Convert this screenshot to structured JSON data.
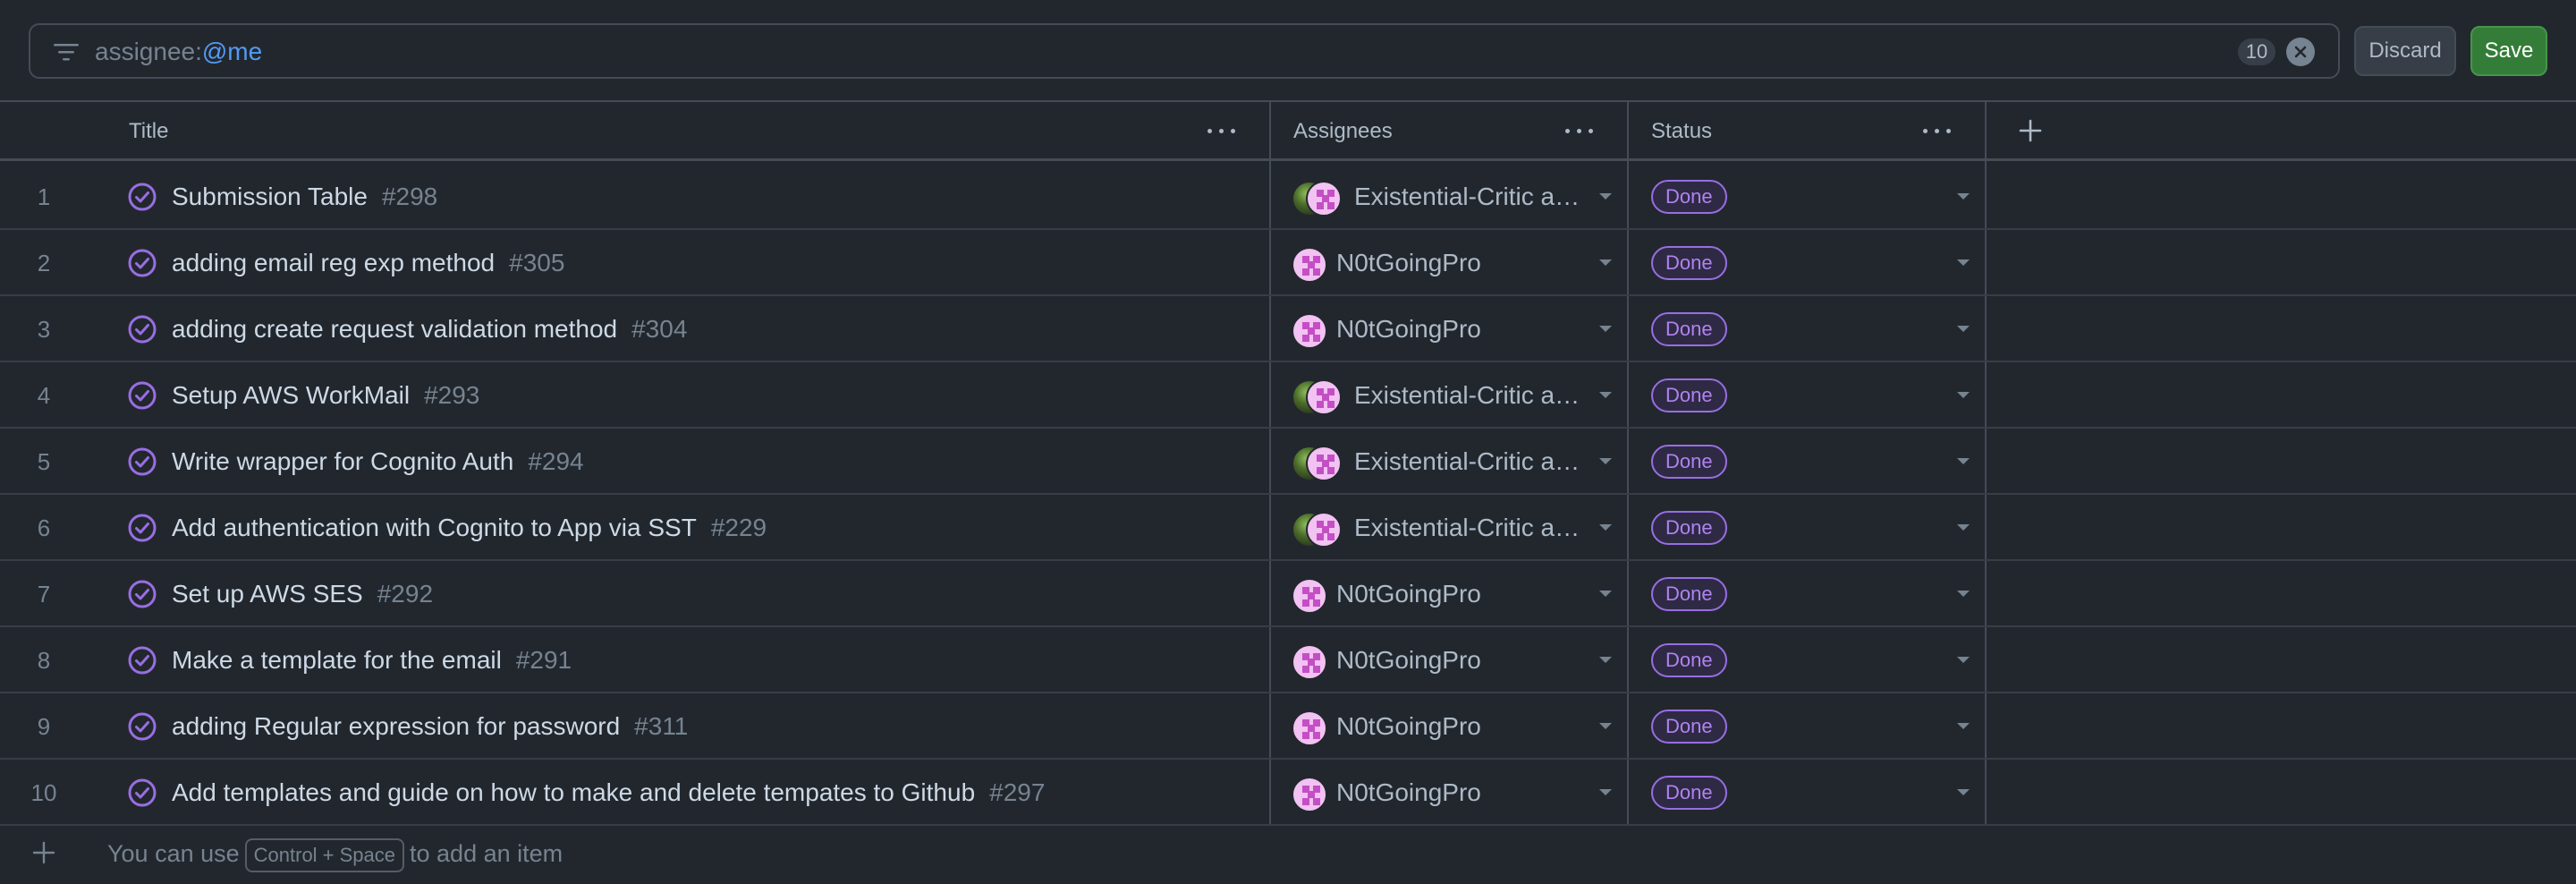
{
  "filter": {
    "prefix": "assignee:",
    "mention": "@me",
    "count": "10",
    "discard_label": "Discard",
    "save_label": "Save"
  },
  "columns": {
    "title": "Title",
    "assignees": "Assignees",
    "status": "Status"
  },
  "rows": [
    {
      "n": "1",
      "title": "Submission Table",
      "num": "#298",
      "assignee": "Existential-Critic an...",
      "avatars": "both",
      "status": "Done"
    },
    {
      "n": "2",
      "title": "adding email reg exp method",
      "num": "#305",
      "assignee": "N0tGoingPro",
      "avatars": "pink",
      "status": "Done"
    },
    {
      "n": "3",
      "title": "adding create request validation method",
      "num": "#304",
      "assignee": "N0tGoingPro",
      "avatars": "pink",
      "status": "Done"
    },
    {
      "n": "4",
      "title": "Setup AWS WorkMail",
      "num": "#293",
      "assignee": "Existential-Critic an...",
      "avatars": "both",
      "status": "Done"
    },
    {
      "n": "5",
      "title": "Write wrapper for Cognito Auth",
      "num": "#294",
      "assignee": "Existential-Critic an...",
      "avatars": "both",
      "status": "Done"
    },
    {
      "n": "6",
      "title": "Add authentication with Cognito to App via SST",
      "num": "#229",
      "assignee": "Existential-Critic an...",
      "avatars": "both",
      "status": "Done"
    },
    {
      "n": "7",
      "title": "Set up AWS SES",
      "num": "#292",
      "assignee": "N0tGoingPro",
      "avatars": "pink",
      "status": "Done"
    },
    {
      "n": "8",
      "title": "Make a template for the email",
      "num": "#291",
      "assignee": "N0tGoingPro",
      "avatars": "pink",
      "status": "Done"
    },
    {
      "n": "9",
      "title": "adding Regular expression for password",
      "num": "#311",
      "assignee": "N0tGoingPro",
      "avatars": "pink",
      "status": "Done"
    },
    {
      "n": "10",
      "title": "Add templates and guide on how to make and delete tempates to Github",
      "num": "#297",
      "assignee": "N0tGoingPro",
      "avatars": "pink",
      "status": "Done"
    }
  ],
  "footer": {
    "before": "You can use",
    "shortcut": "Control + Space",
    "after": "to add an item"
  },
  "colors": {
    "background": "#22272e",
    "accent_blue": "#539bf5",
    "done_purple": "#986ee2",
    "save_green": "#347d39"
  }
}
